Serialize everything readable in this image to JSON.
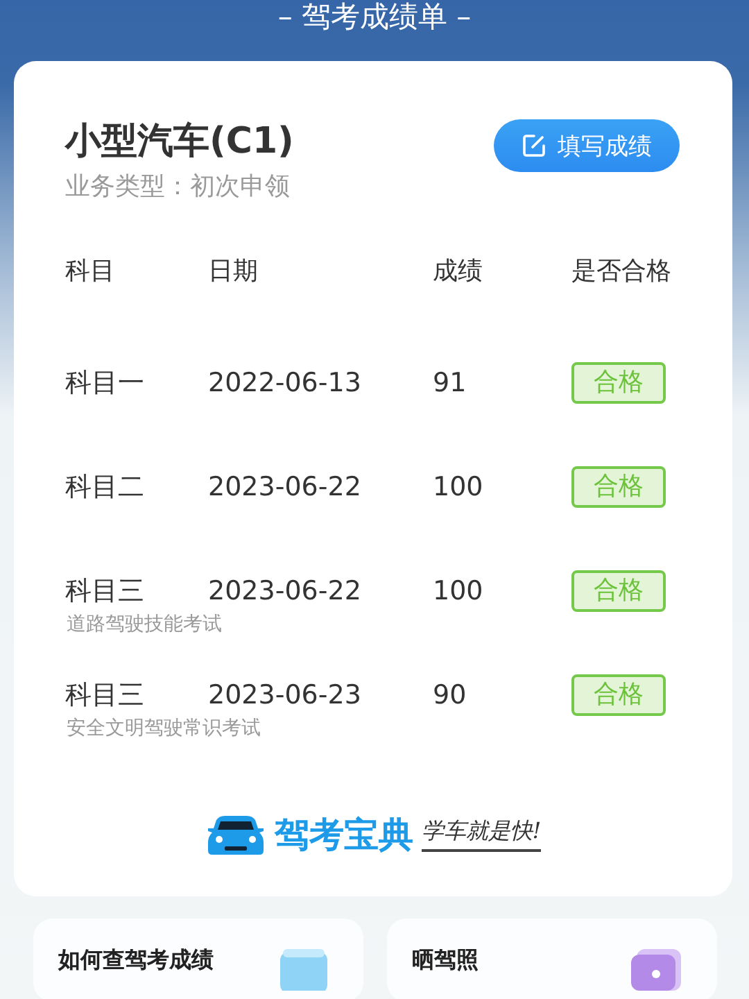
{
  "header": {
    "title": "– 驾考成绩单 –"
  },
  "card": {
    "vehicle": "小型汽车(C1)",
    "business_type": "业务类型：初次申领",
    "fill_button": "填写成绩",
    "table": {
      "columns": [
        "科目",
        "日期",
        "成绩",
        "是否合格"
      ],
      "rows": [
        {
          "subject": "科目一",
          "date": "2022-06-13",
          "score": "91",
          "result": "合格",
          "passed": true
        },
        {
          "subject": "科目二",
          "date": "2023-06-22",
          "score": "100",
          "result": "合格",
          "passed": true
        },
        {
          "subject": "科目三",
          "date": "2023-06-22",
          "score": "100",
          "result": "合格",
          "passed": true,
          "note": "道路驾驶技能考试"
        },
        {
          "subject": "科目三",
          "date": "2023-06-23",
          "score": "90",
          "result": "合格",
          "passed": true,
          "note": "安全文明驾驶常识考试"
        }
      ]
    },
    "brand": {
      "name": "驾考宝典",
      "slogan": "学车就是快!"
    }
  },
  "shortcuts": [
    {
      "title": "如何查驾考成绩",
      "kind": "doc"
    },
    {
      "title": "晒驾照",
      "kind": "photo"
    }
  ]
}
